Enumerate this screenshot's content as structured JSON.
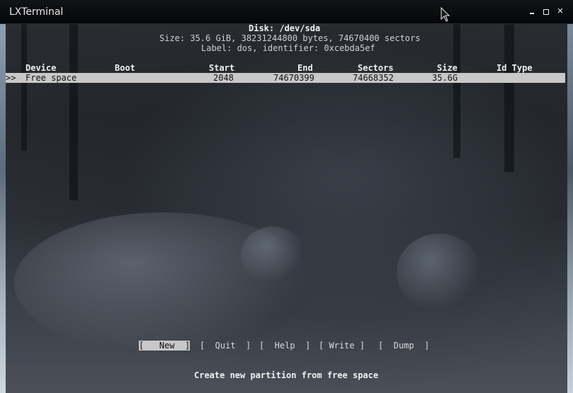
{
  "window": {
    "title": "LXTerminal",
    "controls": {
      "minimize_icon": "minimize-icon",
      "maximize_icon": "maximize-icon",
      "close_icon": "close-icon"
    }
  },
  "terminal": {
    "disk_title": "Disk: /dev/sda",
    "size_line": "Size: 35.6 GiB, 38231244800 bytes, 74670400 sectors",
    "label_line": "Label: dos, identifier: 0xcebda5ef",
    "table": {
      "headers": {
        "device": "Device",
        "boot": "Boot",
        "start": "Start",
        "end": "End",
        "sectors": "Sectors",
        "size": "Size",
        "id_type": "Id Type"
      },
      "rows": [
        {
          "marker": ">>",
          "device": "Free space",
          "boot": "",
          "start": "2048",
          "end": "74670399",
          "sectors": "74668352",
          "size": "35.6G",
          "id_type": ""
        }
      ]
    },
    "menu": {
      "new": "[   New  ]",
      "quit": "[  Quit  ]",
      "help": "[  Help  ]",
      "write": "[ Write ]",
      "dump": "[  Dump  ]"
    },
    "hint": "Create new partition from free space"
  },
  "colors": {
    "selection_bg": "#c8c8c8",
    "titlebar_bg": "#0a0c0e",
    "text": "#cfcfcf"
  }
}
